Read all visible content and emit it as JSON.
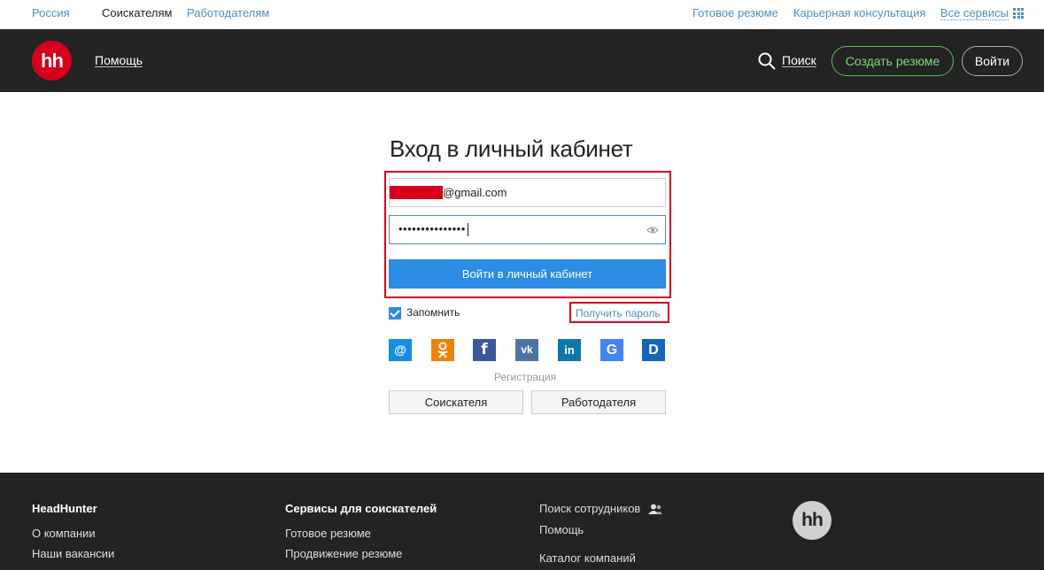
{
  "topbar": {
    "region": "Россия",
    "seekers": "Соискателям",
    "employers": "Работодателям",
    "ready_resume": "Готовое резюме",
    "career": "Карьерная консультация",
    "all_services": "Все сервисы"
  },
  "header": {
    "logo": "hh",
    "help": "Помощь",
    "search": "Поиск",
    "create_resume": "Создать резюме",
    "login": "Войти"
  },
  "login": {
    "title": "Вход в личный кабинет",
    "email_suffix": "@gmail.com",
    "password_mask": "•••••••••••••••",
    "submit": "Войти в личный кабинет",
    "remember": "Запомнить",
    "get_password": "Получить пароль",
    "registration": "Регистрация",
    "reg_seeker": "Соискателя",
    "reg_employer": "Работодателя"
  },
  "social": [
    {
      "name": "mail-ru",
      "glyph": "@",
      "color": "#168de2"
    },
    {
      "name": "odnoklassniki",
      "glyph": "ок",
      "color": "#ee8208"
    },
    {
      "name": "facebook",
      "glyph": "f",
      "color": "#3b5998"
    },
    {
      "name": "vkontakte",
      "glyph": "vk",
      "color": "#4c75a3"
    },
    {
      "name": "linkedin",
      "glyph": "in",
      "color": "#0e76a8"
    },
    {
      "name": "google",
      "glyph": "G",
      "color": "#4285f4"
    },
    {
      "name": "dnevnik",
      "glyph": "D",
      "color": "#1565c0"
    }
  ],
  "footer": {
    "col1": {
      "head": "HeadHunter",
      "items": [
        "О компании",
        "Наши вакансии"
      ]
    },
    "col2": {
      "head": "Сервисы для соискателей",
      "items": [
        "Готовое резюме",
        "Продвижение резюме"
      ]
    },
    "col3": {
      "items": [
        "Поиск сотрудников",
        "Помощь",
        "Каталог компаний"
      ]
    },
    "logo": "hh"
  },
  "colors": {
    "accent": "#2a8ce2",
    "brand": "#d6001c",
    "header_bg": "#232323",
    "highlight": "#d6001c"
  }
}
